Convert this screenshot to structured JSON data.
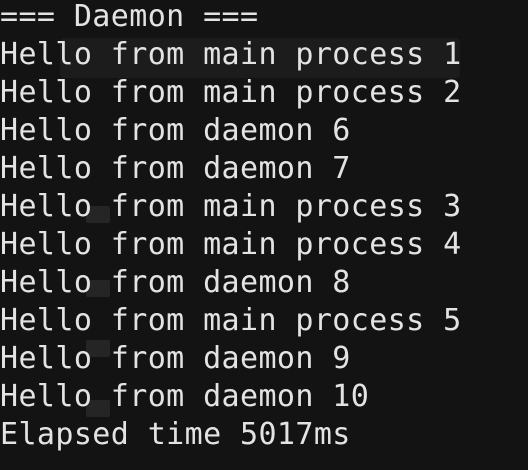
{
  "terminal": {
    "lines": [
      "=== Daemon ===",
      "Hello from main process 1",
      "Hello from main process 2",
      "Hello from daemon 6",
      "Hello from daemon 7",
      "Hello from main process 3",
      "Hello from main process 4",
      "Hello from daemon 8",
      "Hello from main process 5",
      "Hello from daemon 9",
      "Hello from daemon 10",
      "Elapsed time 5017ms"
    ]
  },
  "colors": {
    "background": "#131313",
    "foreground": "#e3e3e3"
  }
}
